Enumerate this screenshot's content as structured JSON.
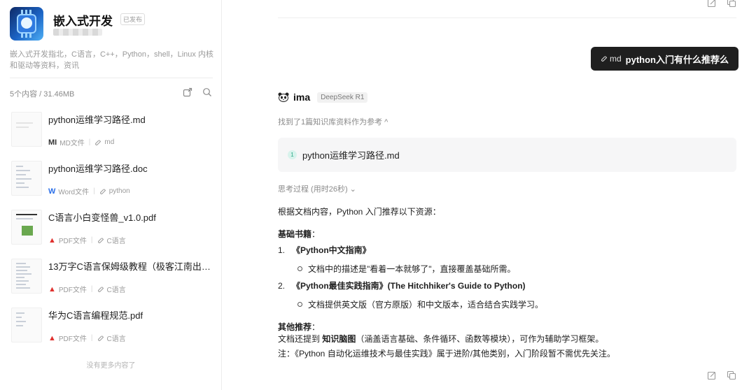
{
  "sidebar": {
    "kb_title": "嵌入式开发",
    "kb_status": "已发布",
    "kb_description": "嵌入式开发指北，C语言，C++，Python，shell，Linux 内核和驱动等资料，资讯",
    "stats": "5个内容 / 31.46MB",
    "files": [
      {
        "name": "python运维学习路径.md",
        "type_icon": "MI",
        "type_label": "MD文件",
        "tag": "md"
      },
      {
        "name": "python运维学习路径.doc",
        "type_icon": "W",
        "type_label": "Word文件",
        "tag": "python"
      },
      {
        "name": "C语言小白变怪兽_v1.0.pdf",
        "type_icon": "▲",
        "type_label": "PDF文件",
        "tag": "C语言"
      },
      {
        "name": "13万字C语言保姆级教程（极客江南出品...",
        "type_icon": "▲",
        "type_label": "PDF文件",
        "tag": "C语言"
      },
      {
        "name": "华为C语言编程规范.pdf",
        "type_icon": "▲",
        "type_label": "PDF文件",
        "tag": "C语言"
      }
    ],
    "no_more": "没有更多内容了"
  },
  "chat": {
    "user_message": {
      "ref_label": "md",
      "question": "python入门有什么推荐么"
    },
    "assistant": {
      "name": "ima",
      "model": "DeepSeek R1",
      "references_label": "找到了1篇知识库资料作为参考 ^",
      "reference": {
        "num": "1",
        "name": "python运维学习路径.md"
      },
      "thinking_label": "思考过程 (用时26秒) ⌄",
      "intro": "根据文档内容，Python 入门推荐以下资源：",
      "section1_title": "基础书籍",
      "section1_colon": "：",
      "book1_num": "1.",
      "book1_title": "《Python中文指南》",
      "book1_desc": "文档中的描述是\"看着一本就够了\"，直接覆盖基础所需。",
      "book2_num": "2.",
      "book2_title": "《Python最佳实践指南》(The Hitchhiker's Guide to Python)",
      "book2_desc": "文档提供英文版（官方原版）和中文版本，适合结合实践学习。",
      "section2_title": "其他推荐",
      "section2_colon": "：",
      "other_prefix": "文档还提到 ",
      "other_bold": "知识脑图",
      "other_rest": "（涵盖语言基础、条件循环、函数等模块），可作为辅助学习框架。",
      "note": "注：《Python 自动化运维技术与最佳实践》属于进阶/其他类别，入门阶段暂不需优先关注。"
    }
  },
  "colors": {
    "bubble": "#1f1f1f",
    "pdf": "#e0312e",
    "word": "#2b6fe8",
    "accent_green": "#2aa786"
  }
}
